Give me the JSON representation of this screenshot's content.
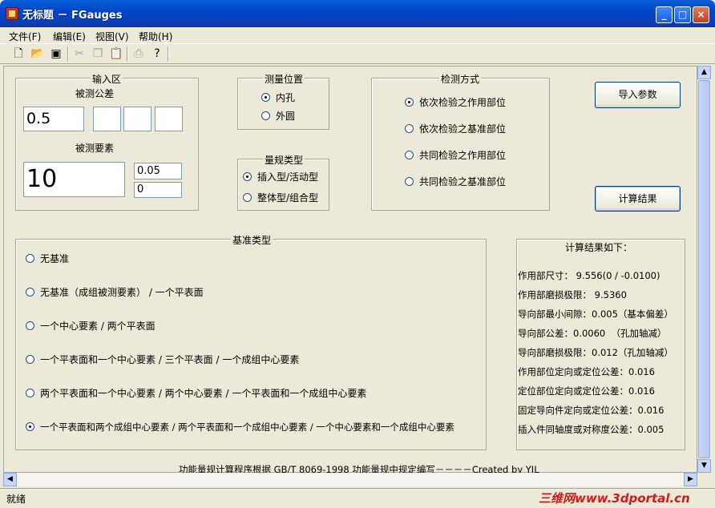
{
  "window": {
    "title": "无标题 － FGauges"
  },
  "menu": [
    "文件(F)",
    "编辑(E)",
    "视图(V)",
    "帮助(H)"
  ],
  "toolbar": {
    "icons": [
      "new-file-icon",
      "open-folder-icon",
      "save-icon",
      "cut-icon",
      "copy-icon",
      "paste-icon",
      "print-icon",
      "help-icon"
    ],
    "disabled": [
      "cut-icon",
      "copy-icon",
      "paste-icon",
      "print-icon"
    ]
  },
  "input_group": {
    "legend": "输入区",
    "tolerance_label": "被测公差",
    "tolerance_value": "0.5",
    "tolerance_extra": [
      "",
      "",
      ""
    ],
    "element_label": "被测要素",
    "element_value": "10",
    "upper": "0.05",
    "lower": "0"
  },
  "position_group": {
    "legend": "测量位置",
    "options": [
      "内孔",
      "外圆"
    ],
    "selected": 0
  },
  "gauge_group": {
    "legend": "量规类型",
    "options": [
      "插入型/活动型",
      "整体型/组合型"
    ],
    "selected": 0
  },
  "method_group": {
    "legend": "检测方式",
    "options": [
      "依次检验之作用部位",
      "依次检验之基准部位",
      "共同检验之作用部位",
      "共同检验之基准部位"
    ],
    "selected": 0
  },
  "buttons": {
    "import": "导入参数",
    "calculate": "计算结果"
  },
  "datum_group": {
    "legend": "基准类型",
    "options": [
      "无基准",
      "无基准（成组被测要素） / 一个平表面",
      "一个中心要素 / 两个平表面",
      "一个平表面和一个中心要素 / 三个平表面 / 一个成组中心要素",
      "两个平表面和一个中心要素 / 两个中心要素 / 一个平表面和一个成组中心要素",
      "一个平表面和两个成组中心要素 / 两个平表面和一个成组中心要素 / 一个中心要素和一个成组中心要素"
    ],
    "selected": 5
  },
  "results": {
    "title": "计算结果如下：",
    "lines": [
      "作用部尺寸： 9.556(0 / -0.0100)",
      "作用部磨损极限： 9.5360",
      "导向部最小间隙：0.005（基本偏差）",
      "导向部公差：0.0060  （孔加轴减）",
      "导向部磨损极限：0.012（孔加轴减）",
      "作用部位定向或定位公差：0.016",
      "定位部位定向或定位公差：0.016",
      "固定导向件定向或定位公差：0.016",
      "插入件同轴度或对称度公差：0.005"
    ]
  },
  "footer": "功能量规计算程序根据 GB/T 8069-1998 功能量规中规定编写－－－－Created by YJL",
  "status": "就绪",
  "watermark": "三维网www.3dportal.cn",
  "colors": {
    "titlebar": "#0046c8",
    "face": "#ece9d8",
    "close": "#c4421d"
  }
}
